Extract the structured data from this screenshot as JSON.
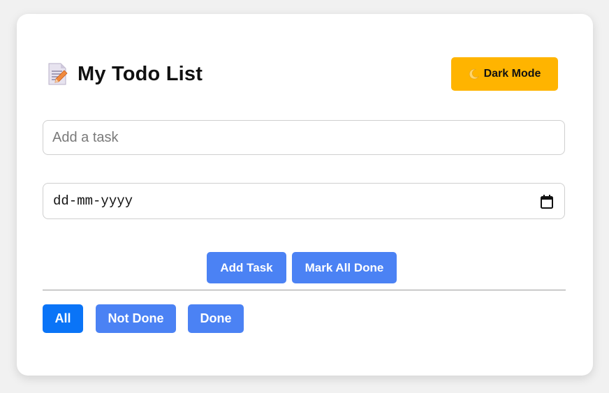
{
  "app": {
    "title": "My Todo List",
    "title_icon": "memo-icon"
  },
  "header": {
    "dark_mode_label": "Dark Mode",
    "dark_mode_icon": "crescent-moon-icon",
    "dark_mode_color": "#ffb400"
  },
  "form": {
    "task_placeholder": "Add a task",
    "task_value": "",
    "date_placeholder": "dd-mm-yyyy",
    "date_icon": "calendar-icon"
  },
  "actions": {
    "add_task_label": "Add Task",
    "mark_all_done_label": "Mark All Done"
  },
  "filters": {
    "items": [
      {
        "label": "All",
        "active": true
      },
      {
        "label": "Not Done",
        "active": false
      },
      {
        "label": "Done",
        "active": false
      }
    ]
  },
  "colors": {
    "primary_button": "#4b82f4",
    "active_filter": "#0a74f7",
    "card_background": "#ffffff",
    "page_background": "#f1f1f1"
  }
}
